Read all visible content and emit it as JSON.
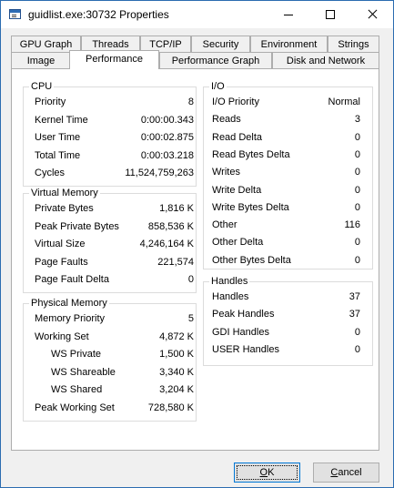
{
  "window": {
    "title": "guidlist.exe:30732 Properties",
    "icon": "app-window-icon",
    "controls": [
      "minimize-icon",
      "maximize-icon",
      "close-icon"
    ]
  },
  "tabs": {
    "row_back": [
      "GPU Graph",
      "Threads",
      "TCP/IP",
      "Security",
      "Environment",
      "Strings"
    ],
    "row_front": [
      "Image",
      "Performance",
      "Performance Graph",
      "Disk and Network"
    ],
    "active": "Performance"
  },
  "cpu": {
    "title": "CPU",
    "rows": [
      {
        "label": "Priority",
        "value": "8"
      },
      {
        "label": "Kernel Time",
        "value": "0:00:00.343"
      },
      {
        "label": "User Time",
        "value": "0:00:02.875"
      },
      {
        "label": "Total Time",
        "value": "0:00:03.218"
      },
      {
        "label": "Cycles",
        "value": "11,524,759,263"
      }
    ]
  },
  "virtual_memory": {
    "title": "Virtual Memory",
    "rows": [
      {
        "label": "Private Bytes",
        "value": "1,816 K"
      },
      {
        "label": "Peak Private Bytes",
        "value": "858,536 K"
      },
      {
        "label": "Virtual Size",
        "value": "4,246,164 K"
      },
      {
        "label": "Page Faults",
        "value": "221,574"
      },
      {
        "label": "Page Fault Delta",
        "value": "0"
      }
    ]
  },
  "physical_memory": {
    "title": "Physical Memory",
    "rows": [
      {
        "label": "Memory Priority",
        "value": "5"
      },
      {
        "label": "Working Set",
        "value": "4,872 K"
      },
      {
        "label": "WS Private",
        "value": "1,500 K"
      },
      {
        "label": "WS Shareable",
        "value": "3,340 K"
      },
      {
        "label": "WS Shared",
        "value": "3,204 K"
      },
      {
        "label": "Peak Working Set",
        "value": "728,580 K"
      }
    ]
  },
  "io": {
    "title": "I/O",
    "rows": [
      {
        "label": "I/O Priority",
        "value": "Normal"
      },
      {
        "label": "Reads",
        "value": "3"
      },
      {
        "label": "Read Delta",
        "value": "0"
      },
      {
        "label": "Read Bytes Delta",
        "value": "0"
      },
      {
        "label": "Writes",
        "value": "0"
      },
      {
        "label": "Write Delta",
        "value": "0"
      },
      {
        "label": "Write Bytes Delta",
        "value": "0"
      },
      {
        "label": "Other",
        "value": "116"
      },
      {
        "label": "Other Delta",
        "value": "0"
      },
      {
        "label": "Other Bytes Delta",
        "value": "0"
      }
    ]
  },
  "handles": {
    "title": "Handles",
    "rows": [
      {
        "label": "Handles",
        "value": "37"
      },
      {
        "label": "Peak Handles",
        "value": "37"
      },
      {
        "label": "GDI Handles",
        "value": "0"
      },
      {
        "label": "USER Handles",
        "value": "0"
      }
    ]
  },
  "buttons": {
    "ok": {
      "mnemonic": "O",
      "rest": "K"
    },
    "cancel": {
      "mnemonic": "C",
      "rest": "ancel"
    }
  }
}
